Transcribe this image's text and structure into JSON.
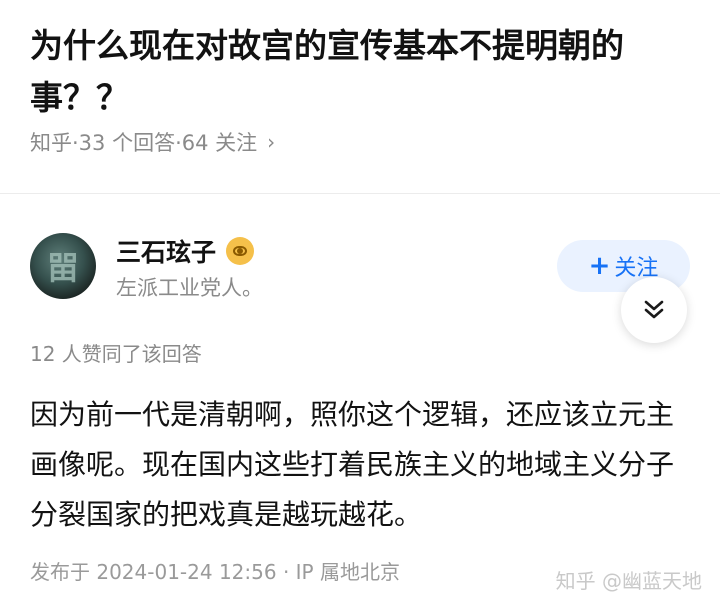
{
  "question": {
    "title": "为什么现在对故宫的宣传基本不提明朝的事？？",
    "meta": "知乎·33 个回答·64 关注",
    "chevron": "›"
  },
  "author": {
    "avatar_glyph": "㽞",
    "name": "三石玹子",
    "bio": "左派工业党人。",
    "follow_plus": "+",
    "follow_label": "关注"
  },
  "answer": {
    "upvote_text": "12 人赞同了该回答",
    "content": "因为前一代是清朝啊，照你这个逻辑，还应该立元主画像呢。现在国内这些打着民族主义的地域主义分子分裂国家的把戏真是越玩越花。",
    "published": "发布于 2024-01-24 12:56 · IP 属地北京"
  },
  "watermark": "知乎 @幽蓝天地",
  "colors": {
    "accent": "#1772f6",
    "follow_bg": "#eaf2ff",
    "muted_text": "#8a8a8a",
    "badge": "#f5c04a"
  }
}
